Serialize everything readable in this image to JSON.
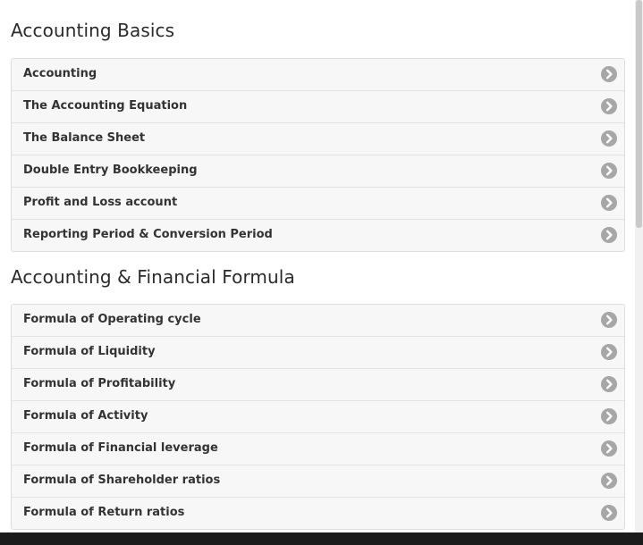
{
  "sections": [
    {
      "title": "Accounting Basics",
      "items": [
        {
          "label": "Accounting"
        },
        {
          "label": "The Accounting Equation"
        },
        {
          "label": "The Balance Sheet"
        },
        {
          "label": "Double Entry Bookkeeping"
        },
        {
          "label": "Profit and Loss account"
        },
        {
          "label": "Reporting Period & Conversion Period"
        }
      ]
    },
    {
      "title": "Accounting & Financial Formula",
      "items": [
        {
          "label": "Formula of Operating cycle"
        },
        {
          "label": "Formula of Liquidity"
        },
        {
          "label": "Formula of Profitability"
        },
        {
          "label": "Formula of Activity"
        },
        {
          "label": "Formula of Financial leverage"
        },
        {
          "label": "Formula of Shareholder ratios"
        },
        {
          "label": "Formula of Return ratios"
        }
      ]
    }
  ],
  "icons": {
    "item_arrow": "chevron-right-circle-icon"
  },
  "colors": {
    "background": "#ffffff",
    "list_background": "#f7f7f7",
    "text": "#333333",
    "icon": "#a7a7a7"
  }
}
